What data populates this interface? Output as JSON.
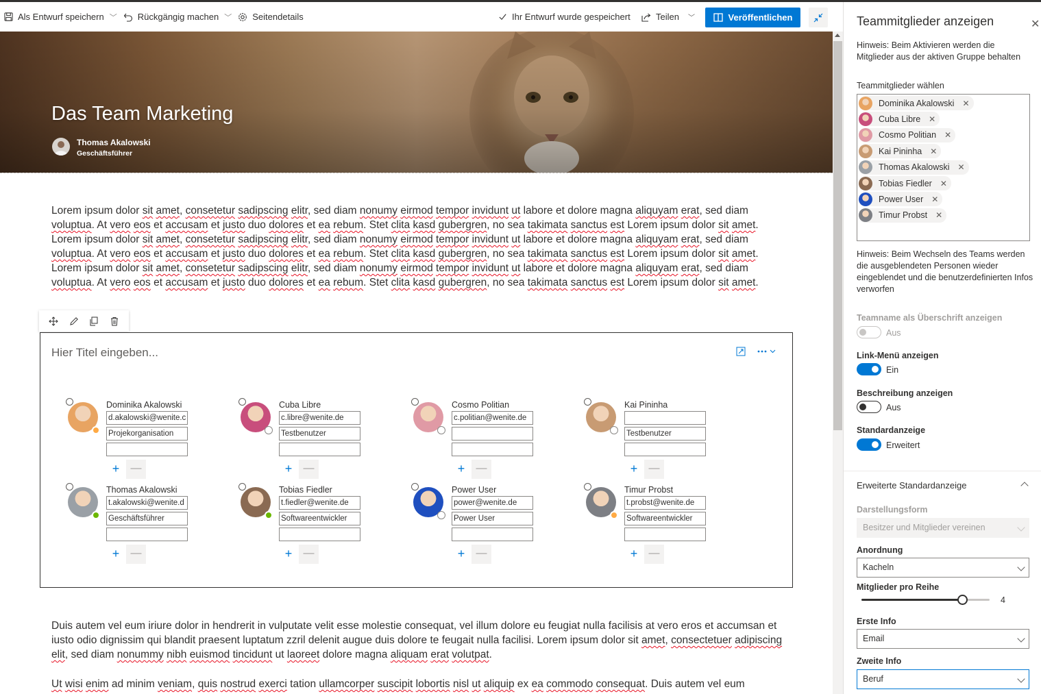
{
  "toolbar": {
    "save_draft": "Als Entwurf speichern",
    "undo": "Rückgängig machen",
    "page_details": "Seitendetails",
    "draft_status": "Ihr Entwurf wurde gespeichert",
    "share": "Teilen",
    "publish": "Veröffentlichen"
  },
  "hero": {
    "title": "Das Team Marketing",
    "author": "Thomas Akalowski",
    "role": "Geschäftsführer"
  },
  "content": {
    "paragraph1": "Lorem ipsum dolor sit amet, consetetur sadipscing elitr, sed diam nonumy eirmod tempor invidunt ut labore et dolore magna aliquyam erat, sed diam voluptua. At vero eos et accusam et justo duo dolores et ea rebum. Stet clita kasd gubergren, no sea takimata sanctus est Lorem ipsum dolor sit amet. Lorem ipsum dolor sit amet, consetetur sadipscing elitr, sed diam nonumy eirmod tempor invidunt ut labore et dolore magna aliquyam erat, sed diam voluptua. At vero eos et accusam et justo duo dolores et ea rebum. Stet clita kasd gubergren, no sea takimata sanctus est Lorem ipsum dolor sit amet. Lorem ipsum dolor sit amet, consetetur sadipscing elitr, sed diam nonumy eirmod tempor invidunt ut labore et dolore magna aliquyam erat, sed diam voluptua. At vero eos et accusam et justo duo dolores et ea rebum. Stet clita kasd gubergren, no sea takimata sanctus est Lorem ipsum dolor sit amet.",
    "paragraph2": "Duis autem vel eum iriure dolor in hendrerit in vulputate velit esse molestie consequat, vel illum dolore eu feugiat nulla facilisis at vero eros et accumsan et iusto odio dignissim qui blandit praesent luptatum zzril delenit augue duis dolore te feugait nulla facilisi. Lorem ipsum dolor sit amet, consectetuer adipiscing elit, sed diam nonummy nibh euismod tincidunt ut laoreet dolore magna aliquam erat volutpat.",
    "paragraph3": "Ut wisi enim ad minim veniam, quis nostrud exerci tation ullamcorper suscipit lobortis nisl ut aliquip ex ea commodo consequat. Duis autem vel eum"
  },
  "webpart": {
    "title_placeholder": "Hier Titel eingeben...",
    "members": [
      {
        "name": "Dominika Akalowski",
        "email": "d.akalowski@wenite.c",
        "info2": "Projekorganisation",
        "presence": "away",
        "color": "#e8a462"
      },
      {
        "name": "Cuba Libre",
        "email": "c.libre@wenite.de",
        "info2": "Testbenutzer",
        "presence": "offline",
        "color": "#c84e7c"
      },
      {
        "name": "Cosmo Politian",
        "email": "c.politian@wenite.de",
        "info2": "",
        "presence": "offline",
        "color": "#e09aa5"
      },
      {
        "name": "Kai Pininha",
        "email": "",
        "info2": "Testbenutzer",
        "presence": "offline",
        "color": "#c89b73"
      },
      {
        "name": "Thomas Akalowski",
        "email": "t.akalowski@wenite.d",
        "info2": "Geschäftsführer",
        "presence": "available",
        "color": "#9aa0a6"
      },
      {
        "name": "Tobias Fiedler",
        "email": "t.fiedler@wenite.de",
        "info2": "Softwareentwickler",
        "presence": "available",
        "color": "#8a6a52"
      },
      {
        "name": "Power User",
        "email": "power@wenite.de",
        "info2": "Power User",
        "presence": "offline",
        "color": "#1f4fbf"
      },
      {
        "name": "Timur Probst",
        "email": "t.probst@wenite.de",
        "info2": "Softwareentwickler",
        "presence": "away",
        "color": "#7d7f84"
      }
    ]
  },
  "panel": {
    "title": "Teammitglieder anzeigen",
    "hint1": "Hinweis: Beim Aktivieren werden die Mitglieder aus der aktiven Gruppe behalten",
    "picker_label": "Teammitglieder wählen",
    "chips": [
      "Dominika Akalowski",
      "Cuba Libre",
      "Cosmo Politian",
      "Kai Pininha",
      "Thomas Akalowski",
      "Tobias Fiedler",
      "Power User",
      "Timur Probst"
    ],
    "hint2": "Hinweis: Beim Wechseln des Teams werden die ausgeblendeten Personen wieder eingeblendet und die benutzerdefinierten Infos verworfen",
    "teamname_label": "Teamname als Überschrift anzeigen",
    "teamname_state": "Aus",
    "linkmenu_label": "Link-Menü anzeigen",
    "linkmenu_state": "Ein",
    "description_label": "Beschreibung anzeigen",
    "description_state": "Aus",
    "default_view_label": "Standardanzeige",
    "default_view_state": "Erweitert",
    "section_title": "Erweiterte Standardanzeige",
    "display_form_label": "Darstellungsform",
    "display_form_value": "Besitzer und Mitglieder vereinen",
    "arrangement_label": "Anordnung",
    "arrangement_value": "Kacheln",
    "per_row_label": "Mitglieder pro Reihe",
    "per_row_value": "4",
    "first_info_label": "Erste Info",
    "first_info_value": "Email",
    "second_info_label": "Zweite Info",
    "second_info_value": "Beruf"
  },
  "colors": {
    "accent": "#0078d4",
    "available": "#6bb700",
    "away": "#ffaa44"
  }
}
